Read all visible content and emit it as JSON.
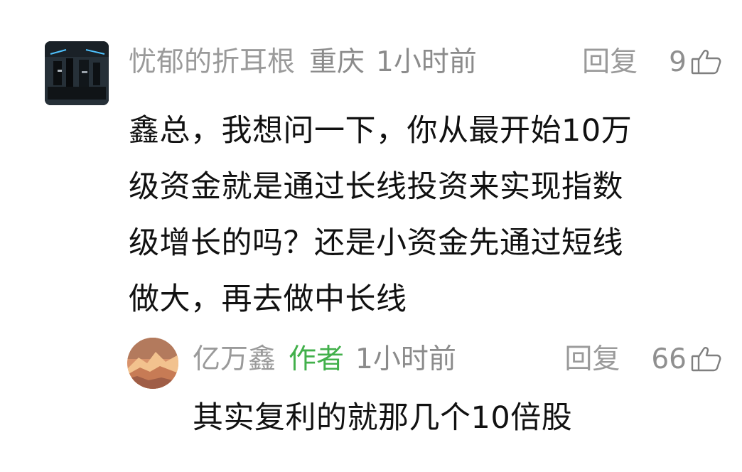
{
  "comment": {
    "username": "忧郁的折耳根",
    "location": "重庆",
    "time": "1小时前",
    "reply_label": "回复",
    "like_count": "9",
    "text_lines": [
      "鑫总，我想问一下，你从最开始10万",
      "级资金就是通过长线投资来实现指数",
      "级增长的吗？还是小资金先通过短线",
      "做大，再去做中长线"
    ]
  },
  "reply": {
    "username": "亿万鑫",
    "author_badge": "作者",
    "time": "1小时前",
    "reply_label": "回复",
    "like_count": "66",
    "text": "其实复利的就那几个10倍股"
  },
  "colors": {
    "meta": "#8b8b8b",
    "author_badge": "#42b04b",
    "text": "#111111"
  },
  "icons": {
    "like": "thumbs-up-icon"
  }
}
